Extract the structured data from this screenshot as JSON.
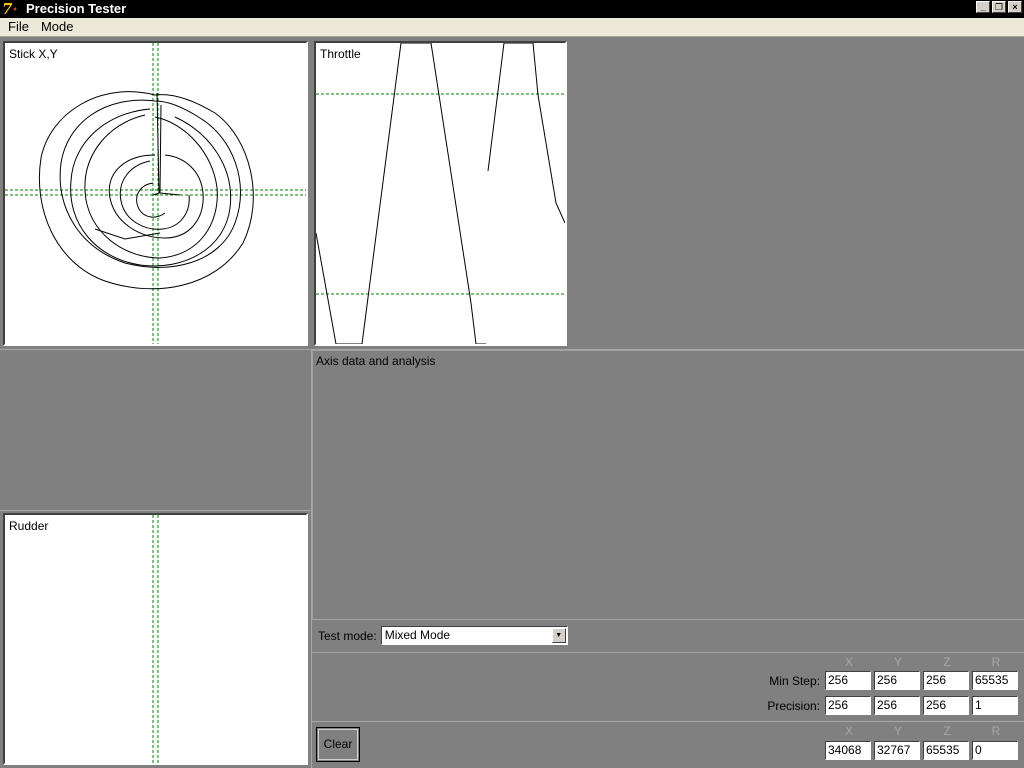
{
  "window": {
    "title": "Precision Tester",
    "icon": "app-7-icon"
  },
  "menu": {
    "items": [
      "File",
      "Mode"
    ]
  },
  "panels": {
    "stick": {
      "label": "Stick X,Y"
    },
    "throttle": {
      "label": "Throttle"
    },
    "rudder": {
      "label": "Rudder"
    }
  },
  "analysis": {
    "label": "Axis data and analysis"
  },
  "test_mode": {
    "label": "Test mode:",
    "value": "Mixed Mode"
  },
  "columns": [
    "X",
    "Y",
    "Z",
    "R"
  ],
  "min_step": {
    "label": "Min Step:",
    "values": [
      "256",
      "256",
      "256",
      "65535"
    ]
  },
  "precision": {
    "label": "Precision:",
    "values": [
      "256",
      "256",
      "256",
      "1"
    ]
  },
  "current": {
    "values": [
      "34068",
      "32767",
      "65535",
      "0"
    ]
  },
  "clear_button": {
    "label": "Clear"
  },
  "colors": {
    "guide": "#008000",
    "trace": "#000000",
    "background": "#808080"
  }
}
